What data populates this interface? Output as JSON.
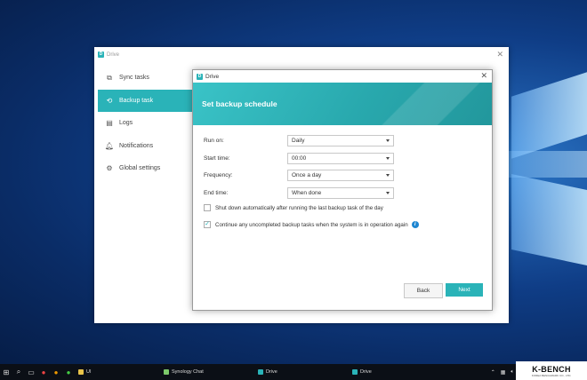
{
  "main_window": {
    "title": "Drive"
  },
  "sidebar": {
    "items": [
      {
        "label": "Sync tasks",
        "icon": "sync-icon"
      },
      {
        "label": "Backup task",
        "icon": "backup-icon",
        "active": true
      },
      {
        "label": "Logs",
        "icon": "logs-icon"
      },
      {
        "label": "Notifications",
        "icon": "bell-icon"
      },
      {
        "label": "Global settings",
        "icon": "gear-icon"
      }
    ]
  },
  "dialog": {
    "title": "Drive",
    "header": "Set backup schedule",
    "fields": [
      {
        "label": "Run on:",
        "value": "Daily"
      },
      {
        "label": "Start time:",
        "value": "00:00"
      },
      {
        "label": "Frequency:",
        "value": "Once a day"
      },
      {
        "label": "End time:",
        "value": "When done"
      }
    ],
    "options": [
      {
        "label": "Shut down automatically after running the last backup task of the day",
        "checked": false
      },
      {
        "label": "Continue any uncompleted backup tasks when the system is in operation again",
        "checked": true
      }
    ],
    "back_label": "Back",
    "next_label": "Next"
  },
  "taskbar": {
    "folder_label": "UI",
    "apps": [
      "Synology Chat",
      "Drive",
      "Drive"
    ]
  },
  "brand": {
    "name": "K-BENCH",
    "tagline": "KOREA BENCHMARK CO., LTD."
  },
  "colors": {
    "accent": "#2ab3b8",
    "info": "#1f86d1"
  }
}
